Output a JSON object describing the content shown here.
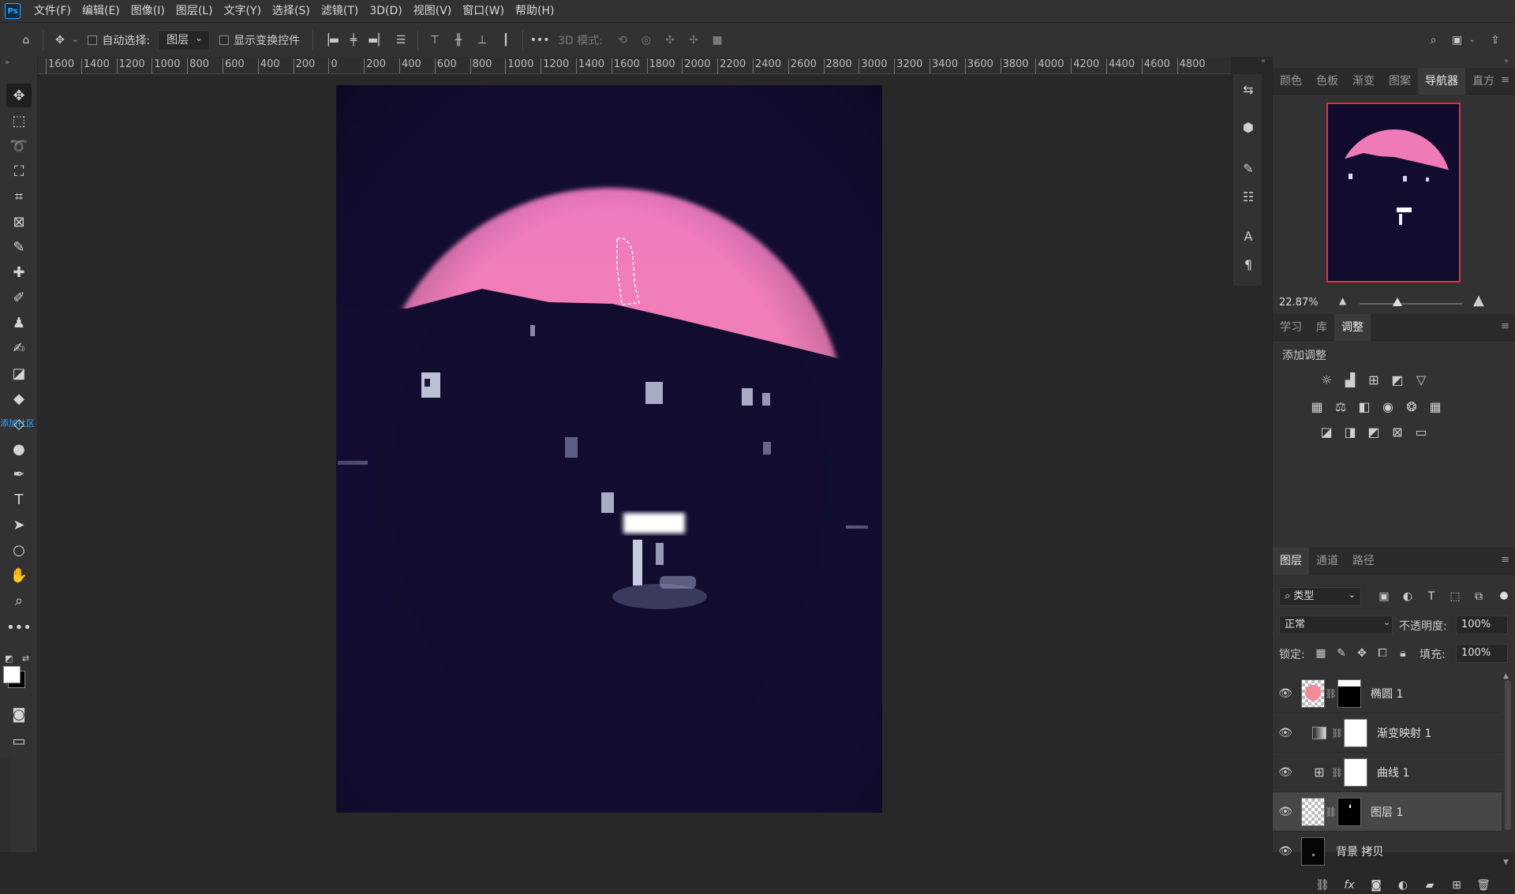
{
  "menu": [
    "文件(F)",
    "编辑(E)",
    "图像(I)",
    "图层(L)",
    "文字(Y)",
    "选择(S)",
    "滤镜(T)",
    "3D(D)",
    "视图(V)",
    "窗口(W)",
    "帮助(H)"
  ],
  "options": {
    "auto_select_label": "自动选择:",
    "auto_select_value": "图层",
    "show_transform_label": "显示变换控件",
    "mode_3d_label": "3D 模式:"
  },
  "ruler_ticks": [
    "1600",
    "1400",
    "1200",
    "1000",
    "800",
    "600",
    "400",
    "200",
    "0",
    "200",
    "400",
    "600",
    "800",
    "1000",
    "1200",
    "1400",
    "1600",
    "1800",
    "2000",
    "2200",
    "2400",
    "2600",
    "2800",
    "3000",
    "3200",
    "3400",
    "3600",
    "3800",
    "4000",
    "4200",
    "4400",
    "4600",
    "4800"
  ],
  "toolbar_overlay_text": "添加社区",
  "top_panel": {
    "tabs": [
      "颜色",
      "色板",
      "渐变",
      "图案",
      "导航器",
      "直方"
    ],
    "active_tab": "导航器",
    "zoom": "22.87%"
  },
  "middle_panel": {
    "tabs": [
      "学习",
      "库",
      "调整"
    ],
    "active_tab": "调整",
    "add_adjustment_label": "添加调整"
  },
  "layers_panel": {
    "tabs": [
      "图层",
      "通道",
      "路径"
    ],
    "active_tab": "图层",
    "filter_kind": "类型",
    "blend_mode": "正常",
    "opacity_label": "不透明度:",
    "opacity_value": "100%",
    "lock_label": "锁定:",
    "fill_label": "填充:",
    "fill_value": "100%",
    "layers": [
      {
        "name": "椭圆 1",
        "selected": false
      },
      {
        "name": "渐变映射 1",
        "selected": false
      },
      {
        "name": "曲线 1",
        "selected": false
      },
      {
        "name": "图层 1",
        "selected": true
      },
      {
        "name": "背景 拷贝",
        "selected": false
      }
    ]
  },
  "colors": {
    "canvas_bg": "#110c2e",
    "sun_pink": "#f07ab8",
    "navigator_frame": "#e0303a"
  }
}
